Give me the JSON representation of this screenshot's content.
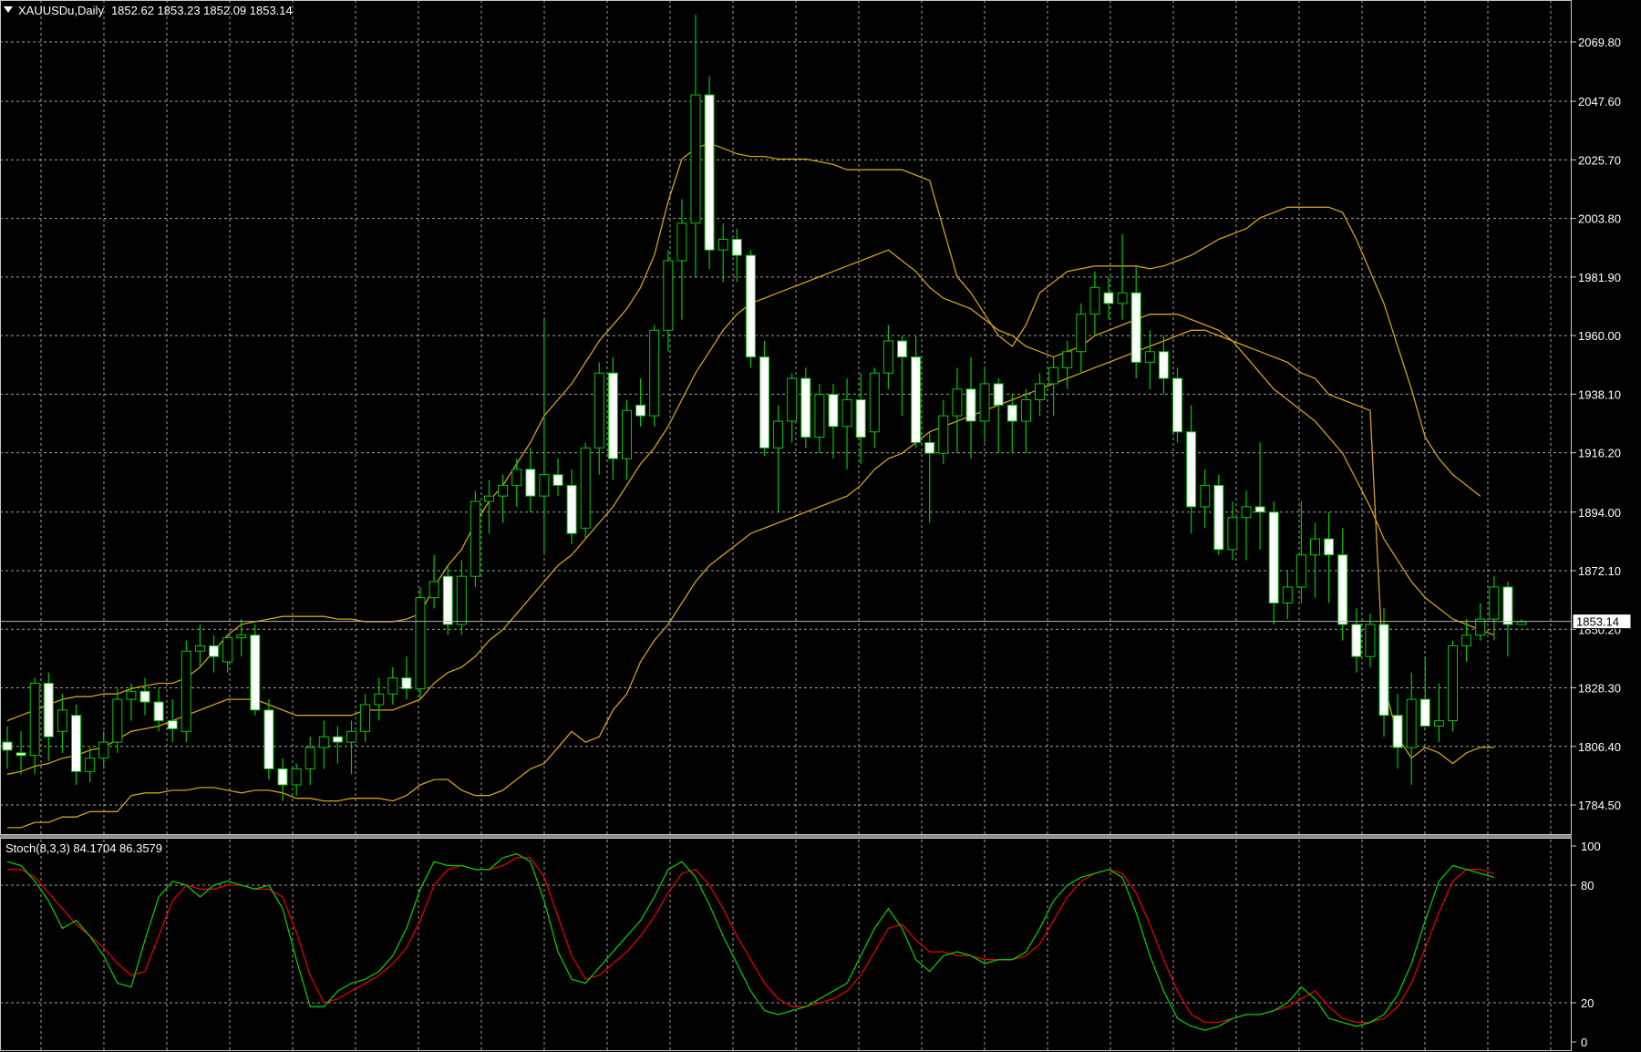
{
  "main_panel": {
    "symbol": "XAUUSDu",
    "timeframe": "Daily",
    "ohlc": "1852.62 1853.23 1852.09 1853.14",
    "current_price_label": "1853.14",
    "price_ticks": [
      "2069.80",
      "2047.60",
      "2025.70",
      "2003.80",
      "1981.90",
      "1960.00",
      "1938.10",
      "1916.20",
      "1894.00",
      "1872.10",
      "1850.20",
      "1828.30",
      "1806.40",
      "1784.50"
    ]
  },
  "stoch_panel": {
    "title": "Stoch(8,3,3) 84.1704 86.3579",
    "ticks": [
      "100",
      "80",
      "20",
      "0"
    ]
  },
  "colors": {
    "background": "#000000",
    "grid": "#c8c8c8",
    "bull_candle": "#000000",
    "bear_candle": "#ffffff",
    "wick": "#00c800",
    "bollinger": "#d4a017",
    "stoch_main": "#00c800",
    "stoch_signal": "#e00000",
    "text": "#ffffff"
  },
  "chart_data": [
    {
      "type": "candlestick",
      "ylim": [
        1778,
        2080
      ],
      "candles": [
        [
          1808,
          1814,
          1798,
          1805
        ],
        [
          1804,
          1812,
          1796,
          1803
        ],
        [
          1803,
          1832,
          1796,
          1830
        ],
        [
          1830,
          1834,
          1801,
          1810
        ],
        [
          1812,
          1826,
          1804,
          1820
        ],
        [
          1818,
          1822,
          1792,
          1797
        ],
        [
          1797,
          1806,
          1793,
          1802
        ],
        [
          1802,
          1812,
          1798,
          1808
        ],
        [
          1808,
          1828,
          1804,
          1824
        ],
        [
          1824,
          1830,
          1816,
          1827
        ],
        [
          1827,
          1832,
          1818,
          1823
        ],
        [
          1823,
          1828,
          1812,
          1816
        ],
        [
          1816,
          1824,
          1808,
          1813
        ],
        [
          1812,
          1846,
          1808,
          1842
        ],
        [
          1842,
          1852,
          1836,
          1844
        ],
        [
          1844,
          1848,
          1834,
          1840
        ],
        [
          1838,
          1848,
          1834,
          1847
        ],
        [
          1847,
          1854,
          1840,
          1848
        ],
        [
          1848,
          1852,
          1818,
          1820
        ],
        [
          1820,
          1824,
          1794,
          1798
        ],
        [
          1798,
          1802,
          1786,
          1792
        ],
        [
          1792,
          1800,
          1788,
          1798
        ],
        [
          1798,
          1810,
          1792,
          1806
        ],
        [
          1806,
          1816,
          1798,
          1810
        ],
        [
          1810,
          1814,
          1800,
          1808
        ],
        [
          1808,
          1816,
          1796,
          1812
        ],
        [
          1812,
          1826,
          1808,
          1822
        ],
        [
          1822,
          1832,
          1816,
          1826
        ],
        [
          1826,
          1836,
          1822,
          1832
        ],
        [
          1832,
          1840,
          1824,
          1828
        ],
        [
          1828,
          1866,
          1824,
          1862
        ],
        [
          1862,
          1878,
          1858,
          1868
        ],
        [
          1870,
          1874,
          1848,
          1852
        ],
        [
          1852,
          1876,
          1848,
          1870
        ],
        [
          1870,
          1902,
          1866,
          1898
        ],
        [
          1898,
          1906,
          1886,
          1900
        ],
        [
          1900,
          1908,
          1890,
          1904
        ],
        [
          1904,
          1914,
          1896,
          1910
        ],
        [
          1910,
          1918,
          1894,
          1900
        ],
        [
          1900,
          1966,
          1878,
          1908
        ],
        [
          1908,
          1914,
          1900,
          1904
        ],
        [
          1904,
          1910,
          1882,
          1886
        ],
        [
          1888,
          1920,
          1884,
          1918
        ],
        [
          1918,
          1950,
          1908,
          1946
        ],
        [
          1946,
          1952,
          1906,
          1914
        ],
        [
          1914,
          1936,
          1906,
          1932
        ],
        [
          1934,
          1944,
          1926,
          1930
        ],
        [
          1930,
          1964,
          1926,
          1962
        ],
        [
          1962,
          1992,
          1954,
          1988
        ],
        [
          1988,
          2011,
          1966,
          2002
        ],
        [
          2002,
          2080,
          1982,
          2050
        ],
        [
          2050,
          2057,
          1985,
          1992
        ],
        [
          1992,
          2002,
          1980,
          1996
        ],
        [
          1996,
          2000,
          1980,
          1990
        ],
        [
          1990,
          1992,
          1948,
          1952
        ],
        [
          1952,
          1958,
          1915,
          1918
        ],
        [
          1918,
          1934,
          1894,
          1928
        ],
        [
          1928,
          1946,
          1920,
          1944
        ],
        [
          1944,
          1948,
          1918,
          1922
        ],
        [
          1922,
          1942,
          1916,
          1938
        ],
        [
          1938,
          1942,
          1914,
          1926
        ],
        [
          1926,
          1944,
          1910,
          1936
        ],
        [
          1936,
          1946,
          1912,
          1922
        ],
        [
          1924,
          1948,
          1918,
          1946
        ],
        [
          1946,
          1964,
          1940,
          1958
        ],
        [
          1958,
          1960,
          1930,
          1952
        ],
        [
          1952,
          1960,
          1918,
          1920
        ],
        [
          1920,
          1924,
          1890,
          1916
        ],
        [
          1916,
          1936,
          1912,
          1930
        ],
        [
          1930,
          1948,
          1916,
          1940
        ],
        [
          1940,
          1952,
          1914,
          1928
        ],
        [
          1928,
          1948,
          1920,
          1942
        ],
        [
          1942,
          1944,
          1916,
          1934
        ],
        [
          1934,
          1938,
          1916,
          1928
        ],
        [
          1928,
          1940,
          1916,
          1936
        ],
        [
          1936,
          1946,
          1930,
          1942
        ],
        [
          1942,
          1952,
          1930,
          1948
        ],
        [
          1948,
          1958,
          1940,
          1954
        ],
        [
          1954,
          1972,
          1946,
          1968
        ],
        [
          1968,
          1984,
          1960,
          1978
        ],
        [
          1976,
          1982,
          1966,
          1972
        ],
        [
          1972,
          1998,
          1966,
          1976
        ],
        [
          1976,
          1986,
          1944,
          1950
        ],
        [
          1950,
          1962,
          1940,
          1954
        ],
        [
          1954,
          1960,
          1938,
          1944
        ],
        [
          1944,
          1948,
          1920,
          1924
        ],
        [
          1924,
          1934,
          1886,
          1896
        ],
        [
          1896,
          1910,
          1888,
          1904
        ],
        [
          1904,
          1908,
          1878,
          1880
        ],
        [
          1880,
          1898,
          1876,
          1892
        ],
        [
          1892,
          1902,
          1876,
          1896
        ],
        [
          1896,
          1920,
          1880,
          1894
        ],
        [
          1894,
          1898,
          1852,
          1860
        ],
        [
          1860,
          1872,
          1854,
          1866
        ],
        [
          1866,
          1898,
          1860,
          1878
        ],
        [
          1878,
          1890,
          1862,
          1884
        ],
        [
          1884,
          1894,
          1860,
          1878
        ],
        [
          1878,
          1888,
          1846,
          1852
        ],
        [
          1852,
          1858,
          1834,
          1840
        ],
        [
          1840,
          1856,
          1836,
          1852
        ],
        [
          1852,
          1858,
          1810,
          1818
        ],
        [
          1818,
          1826,
          1798,
          1806
        ],
        [
          1806,
          1834,
          1792,
          1824
        ],
        [
          1824,
          1840,
          1814,
          1814
        ],
        [
          1814,
          1830,
          1808,
          1816
        ],
        [
          1816,
          1846,
          1812,
          1844
        ],
        [
          1844,
          1854,
          1838,
          1848
        ],
        [
          1848,
          1860,
          1846,
          1854
        ],
        [
          1854,
          1870,
          1846,
          1866
        ],
        [
          1866,
          1868,
          1840,
          1852
        ],
        [
          1852,
          1854,
          1852,
          1853
        ]
      ],
      "bollinger_mid": [
        1796,
        1797,
        1799,
        1800,
        1802,
        1803,
        1805,
        1806,
        1809,
        1812,
        1813,
        1814,
        1816,
        1818,
        1820,
        1822,
        1824,
        1824,
        1824,
        1822,
        1820,
        1818,
        1818,
        1818,
        1818,
        1818,
        1820,
        1820,
        1820,
        1822,
        1824,
        1830,
        1834,
        1836,
        1840,
        1846,
        1850,
        1856,
        1862,
        1868,
        1874,
        1878,
        1884,
        1890,
        1896,
        1904,
        1912,
        1918,
        1926,
        1936,
        1946,
        1954,
        1962,
        1968,
        1972,
        1974,
        1976,
        1978,
        1980,
        1982,
        1984,
        1986,
        1988,
        1990,
        1992,
        1988,
        1984,
        1978,
        1974,
        1972,
        1970,
        1966,
        1962,
        1960,
        1956,
        1954,
        1952,
        1954,
        1956,
        1960,
        1962,
        1964,
        1966,
        1968,
        1968,
        1968,
        1966,
        1964,
        1962,
        1958,
        1952,
        1946,
        1940,
        1936,
        1932,
        1928,
        1922,
        1916,
        1906,
        1896,
        1884,
        1876,
        1868,
        1862,
        1858,
        1854,
        1852,
        1850,
        1848
      ],
      "bollinger_upper": [
        1816,
        1818,
        1820,
        1822,
        1824,
        1825,
        1825,
        1826,
        1826,
        1828,
        1829,
        1830,
        1830,
        1832,
        1836,
        1842,
        1848,
        1852,
        1853,
        1854,
        1855,
        1855,
        1855,
        1855,
        1854,
        1854,
        1853,
        1853,
        1853,
        1854,
        1856,
        1866,
        1874,
        1880,
        1890,
        1898,
        1904,
        1912,
        1920,
        1930,
        1936,
        1942,
        1950,
        1958,
        1964,
        1970,
        1978,
        1990,
        2010,
        2026,
        2030,
        2032,
        2030,
        2028,
        2027,
        2027,
        2026,
        2026,
        2026,
        2025,
        2024,
        2022,
        2022,
        2022,
        2022,
        2022,
        2020,
        2018,
        2000,
        1982,
        1976,
        1968,
        1960,
        1956,
        1964,
        1976,
        1980,
        1984,
        1985,
        1986,
        1986,
        1986,
        1986,
        1985,
        1986,
        1988,
        1990,
        1993,
        1996,
        1998,
        2000,
        2004,
        2006,
        2008,
        2008,
        2008,
        2008,
        2006,
        1996,
        1984,
        1972,
        1956,
        1940,
        1922,
        1914,
        1908,
        1904,
        1900
      ],
      "bollinger_lower": [
        1776,
        1776,
        1778,
        1778,
        1780,
        1780,
        1782,
        1782,
        1782,
        1788,
        1789,
        1789,
        1790,
        1790,
        1791,
        1791,
        1790,
        1789,
        1790,
        1790,
        1789,
        1787,
        1787,
        1786,
        1786,
        1787,
        1787,
        1787,
        1786,
        1788,
        1792,
        1794,
        1794,
        1790,
        1788,
        1788,
        1790,
        1794,
        1798,
        1800,
        1806,
        1812,
        1808,
        1810,
        1820,
        1826,
        1838,
        1846,
        1852,
        1860,
        1868,
        1874,
        1878,
        1882,
        1886,
        1888,
        1890,
        1892,
        1894,
        1896,
        1898,
        1900,
        1904,
        1910,
        1914,
        1916,
        1920,
        1924,
        1926,
        1928,
        1930,
        1932,
        1934,
        1936,
        1938,
        1940,
        1942,
        1944,
        1946,
        1948,
        1950,
        1952,
        1954,
        1956,
        1958,
        1960,
        1962,
        1962,
        1960,
        1958,
        1956,
        1954,
        1952,
        1950,
        1946,
        1944,
        1938,
        1936,
        1934,
        1932,
        1830,
        1810,
        1802,
        1806,
        1804,
        1800,
        1804,
        1806,
        1806
      ]
    },
    {
      "type": "line",
      "title": "Stoch(8,3,3) 84.1704 86.3579",
      "ylim": [
        0,
        100
      ],
      "series": [
        {
          "values": [
            92,
            90,
            82,
            72,
            58,
            62,
            54,
            44,
            30,
            28,
            52,
            74,
            82,
            80,
            74,
            80,
            82,
            80,
            78,
            80,
            68,
            42,
            18,
            18,
            26,
            30,
            32,
            36,
            44,
            58,
            78,
            92,
            90,
            90,
            88,
            88,
            94,
            96,
            92,
            72,
            46,
            32,
            30,
            38,
            46,
            54,
            62,
            74,
            88,
            92,
            84,
            70,
            54,
            40,
            26,
            16,
            14,
            16,
            18,
            22,
            26,
            30,
            44,
            58,
            68,
            58,
            42,
            36,
            44,
            46,
            44,
            40,
            42,
            42,
            46,
            58,
            72,
            80,
            84,
            86,
            88,
            84,
            66,
            44,
            26,
            12,
            8,
            6,
            8,
            12,
            14,
            14,
            16,
            20,
            28,
            22,
            12,
            10,
            8,
            10,
            14,
            24,
            40,
            62,
            82,
            90,
            88,
            86,
            84
          ]
        },
        {
          "values": [
            88,
            88,
            84,
            76,
            68,
            60,
            54,
            48,
            40,
            34,
            36,
            54,
            72,
            80,
            78,
            78,
            80,
            80,
            78,
            78,
            74,
            56,
            34,
            20,
            22,
            26,
            30,
            34,
            40,
            48,
            62,
            80,
            88,
            90,
            88,
            88,
            90,
            94,
            94,
            84,
            64,
            44,
            32,
            34,
            40,
            46,
            54,
            64,
            76,
            86,
            88,
            80,
            68,
            54,
            42,
            30,
            22,
            18,
            18,
            20,
            22,
            26,
            34,
            46,
            58,
            60,
            52,
            46,
            46,
            44,
            44,
            42,
            42,
            42,
            44,
            50,
            62,
            74,
            82,
            86,
            88,
            86,
            76,
            60,
            42,
            26,
            14,
            10,
            10,
            12,
            14,
            14,
            16,
            18,
            22,
            26,
            18,
            12,
            10,
            10,
            12,
            18,
            30,
            48,
            66,
            82,
            88,
            88,
            86
          ]
        }
      ]
    }
  ]
}
